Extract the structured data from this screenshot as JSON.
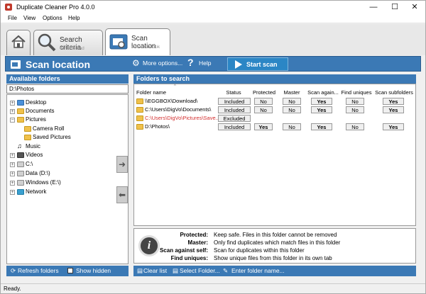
{
  "app": {
    "title": "Duplicate Cleaner Pro 4.0.0"
  },
  "window_controls": {
    "minimize": "—",
    "maximize": "☐",
    "close": "✕"
  },
  "menu": [
    {
      "label": "File"
    },
    {
      "label": "View"
    },
    {
      "label": "Options"
    },
    {
      "label": "Help"
    }
  ],
  "tabs": [
    {
      "title": "",
      "sub": ""
    },
    {
      "title": "Search criteria",
      "sub": "What to find"
    },
    {
      "title": "Scan location",
      "sub": "Where to look"
    }
  ],
  "header": {
    "title": "Scan location",
    "more_options": "More options...",
    "help": "Help",
    "start_scan": "Start scan"
  },
  "available": {
    "title": "Available folders",
    "path": "D:\\Photos",
    "tree": [
      {
        "label": "Desktop",
        "icon": "desktop-icon"
      },
      {
        "label": "Documents",
        "icon": "folder-icon"
      },
      {
        "label": "Pictures",
        "icon": "folder-icon"
      },
      {
        "label": "Camera Roll",
        "icon": "folder-icon"
      },
      {
        "label": "Saved Pictures",
        "icon": "folder-icon"
      },
      {
        "label": "Music",
        "icon": "music-icon"
      },
      {
        "label": "Videos",
        "icon": "video-icon"
      },
      {
        "label": "C:\\",
        "icon": "drive-icon"
      },
      {
        "label": "Data (D:\\)",
        "icon": "drive-icon"
      },
      {
        "label": "Windows (E:\\)",
        "icon": "drive-icon"
      },
      {
        "label": "Network",
        "icon": "network-icon"
      }
    ],
    "refresh": "Refresh folders",
    "show_hidden": "Show hidden"
  },
  "folders": {
    "title": "Folders to search",
    "columns": [
      "Folder name",
      "Status",
      "Protected",
      "Master",
      "Scan again...",
      "Find uniques",
      "Scan subfolders"
    ],
    "rows": [
      {
        "name": "\\\\EGGBOX\\Download\\",
        "status": "Included",
        "protected": "No",
        "master": "No",
        "scan_self": "Yes",
        "uniques": "No",
        "subfolders": "Yes",
        "color": "#000000"
      },
      {
        "name": "C:\\Users\\DigVo\\Documents\\",
        "status": "Included",
        "protected": "No",
        "master": "No",
        "scan_self": "Yes",
        "uniques": "No",
        "subfolders": "Yes",
        "color": "#000000"
      },
      {
        "name": "C:\\Users\\DigVo\\Pictures\\Save...",
        "status": "Excluded",
        "protected": "",
        "master": "",
        "scan_self": "",
        "uniques": "",
        "subfolders": "",
        "color": "#d32f2f"
      },
      {
        "name": "D:\\Photos\\",
        "status": "Included",
        "protected": "Yes",
        "master": "No",
        "scan_self": "Yes",
        "uniques": "No",
        "subfolders": "Yes",
        "color": "#000000"
      }
    ],
    "clear": "Clear list",
    "select": "Select Folder...",
    "enter": "Enter folder name..."
  },
  "info": {
    "rows": [
      {
        "k": "Protected:",
        "v": "Keep safe. Files in this folder cannot be removed"
      },
      {
        "k": "Master:",
        "v": "Only find duplicates which match files in this folder"
      },
      {
        "k": "Scan against self:",
        "v": "Scan for duplicates within this folder"
      },
      {
        "k": "Find uniques:",
        "v": "Show unique files from this folder in its own tab"
      }
    ]
  },
  "status": {
    "text": "Ready."
  },
  "colors": {
    "accent": "#3b79b5",
    "excluded": "#d32f2f"
  }
}
